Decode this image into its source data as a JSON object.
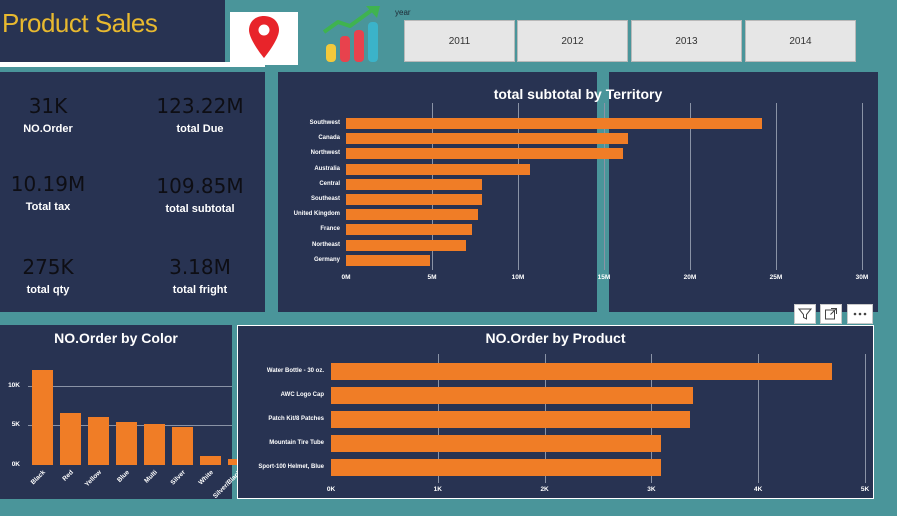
{
  "header": {
    "title": "Product Sales",
    "year_slicer": {
      "label": "year",
      "options": [
        "2011",
        "2012",
        "2013",
        "2014"
      ]
    },
    "icons": [
      "map-pin-icon",
      "growth-chart-icon"
    ]
  },
  "kpis": [
    {
      "value": "31K",
      "label": "NO.Order"
    },
    {
      "value": "123.22M",
      "label": "total Due"
    },
    {
      "value": "10.19M",
      "label": "Total tax"
    },
    {
      "value": "109.85M",
      "label": "total subtotal"
    },
    {
      "value": "275K",
      "label": "total qty"
    },
    {
      "value": "3.18M",
      "label": "total fright"
    }
  ],
  "visual_header": {
    "icons": [
      "filter-icon",
      "focus-mode-icon",
      "more-options-icon"
    ]
  },
  "colors": {
    "background": "#4a959a",
    "panel": "#283352",
    "bar": "#f07d26",
    "title": "#e8b92f"
  },
  "chart_data": [
    {
      "type": "bar",
      "orientation": "horizontal",
      "title": "total subtotal by Territory",
      "categories": [
        "Southwest",
        "Canada",
        "Northwest",
        "Australia",
        "Central",
        "Southeast",
        "United Kingdom",
        "France",
        "Northeast",
        "Germany"
      ],
      "values": [
        24.2,
        16.4,
        16.1,
        10.7,
        7.9,
        7.9,
        7.7,
        7.3,
        7.0,
        4.9
      ],
      "value_unit": "M",
      "xlim": [
        0,
        30
      ],
      "ticks": [
        "0M",
        "5M",
        "10M",
        "15M",
        "20M",
        "25M",
        "30M"
      ],
      "grid": true
    },
    {
      "type": "bar",
      "orientation": "vertical",
      "title": "NO.Order by Color",
      "categories": [
        "Black",
        "Red",
        "Yellow",
        "Blue",
        "Multi",
        "Silver",
        "White",
        "Silver/Black"
      ],
      "values": [
        12000,
        6600,
        6000,
        5400,
        5200,
        4800,
        1100,
        800
      ],
      "ylim": [
        0,
        15000
      ],
      "ticks": [
        "0K",
        "5K",
        "10K"
      ],
      "grid": true
    },
    {
      "type": "bar",
      "orientation": "horizontal",
      "title": "NO.Order by Product",
      "categories": [
        "Water Bottle - 30 oz.",
        "AWC Logo Cap",
        "Patch Kit/8 Patches",
        "Mountain Tire Tube",
        "Sport-100 Helmet, Blue"
      ],
      "values": [
        4690,
        3390,
        3360,
        3090,
        3090
      ],
      "xlim": [
        0,
        5000
      ],
      "ticks": [
        "0K",
        "1K",
        "2K",
        "3K",
        "4K",
        "5K"
      ],
      "grid": true
    }
  ]
}
